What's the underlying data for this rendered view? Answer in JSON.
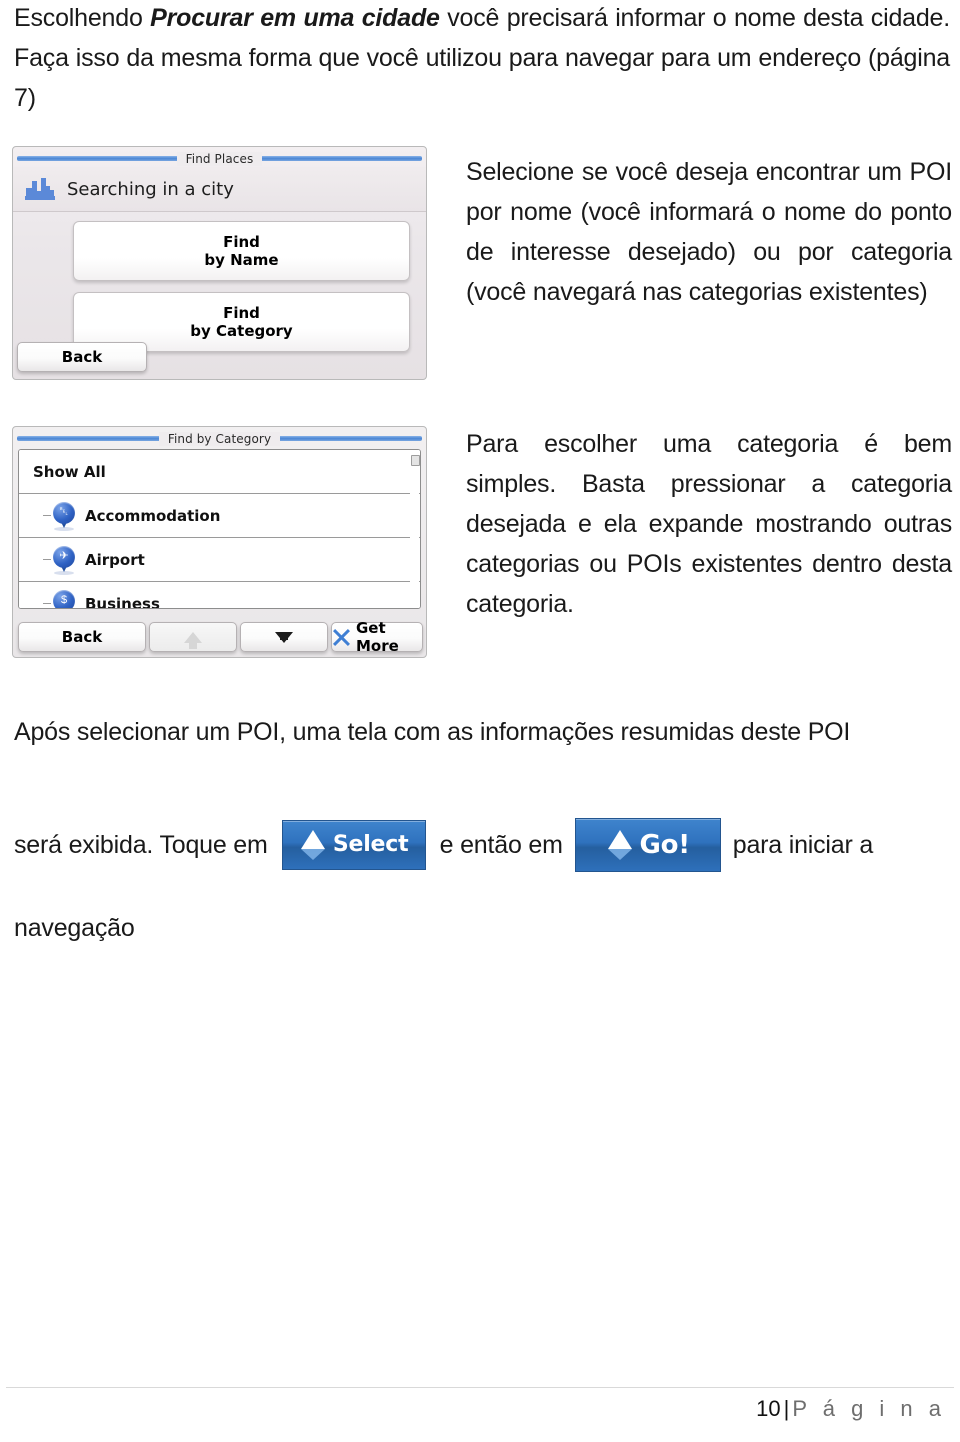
{
  "document": {
    "language": "pt-BR",
    "intro": {
      "lead_before": "Escolhendo ",
      "lead_emphasis": "Procurar em uma cidade",
      "lead_after": " você precisará informar o nome desta cidade. Faça isso da mesma forma que você utilizou para navegar para um endereço (página 7)"
    },
    "right_paragraph_1": "Selecione se você deseja encontrar um POI por nome (você informará o nome do ponto de interesse desejado) ou por categoria (você navegará nas categorias existentes)",
    "right_paragraph_2": "Para escolher uma categoria é bem simples. Basta pressionar a categoria desejada e ela expande mostrando outras categorias ou POIs existentes dentro desta categoria.",
    "bottom_line_1": "Após selecionar um POI, uma tela com as informações resumidas deste POI",
    "bottom_line_2_part_a": "será exibida. Toque em",
    "bottom_line_2_part_b": "e então em",
    "bottom_line_2_part_c": "para iniciar a",
    "bottom_line_3": "navegação"
  },
  "inline_buttons": {
    "select": {
      "label": "Select",
      "icon": "navigation-arrow-icon",
      "background_color": "#2f72be",
      "text_color": "#ffffff"
    },
    "go": {
      "label": "Go!",
      "icon": "navigation-arrow-icon",
      "background_color": "#2f72be",
      "text_color": "#ffffff"
    }
  },
  "gps_find_places": {
    "window_title": "Find Places",
    "header": {
      "icon": "city-skyline-icon",
      "icon_color": "#5b89d8",
      "text": "Searching in a city"
    },
    "buttons": [
      {
        "line1": "Find",
        "line2": "by Name"
      },
      {
        "line1": "Find",
        "line2": "by Category"
      }
    ],
    "footer": {
      "back_label": "Back"
    }
  },
  "gps_find_by_category": {
    "window_title": "Find by Category",
    "list": {
      "show_all_label": "Show All",
      "items": [
        {
          "label": "Accommodation",
          "icon": "bed-pin-icon",
          "glyph": "⛌"
        },
        {
          "label": "Airport",
          "icon": "airplane-pin-icon",
          "glyph": "✈"
        },
        {
          "label": "Business",
          "icon": "money-bag-pin-icon",
          "glyph": "$"
        }
      ],
      "scrollbar": "vertical-scrollbar"
    },
    "footer": {
      "back_label": "Back",
      "scroll_up_icon": "arrow-up-icon",
      "scroll_up_disabled": true,
      "scroll_down_icon": "arrow-down-icon",
      "get_more_label": "Get More",
      "get_more_icon": "star-burst-icon"
    }
  },
  "footer": {
    "page_number": "10",
    "separator": "|",
    "page_word": "P á g i n a"
  }
}
